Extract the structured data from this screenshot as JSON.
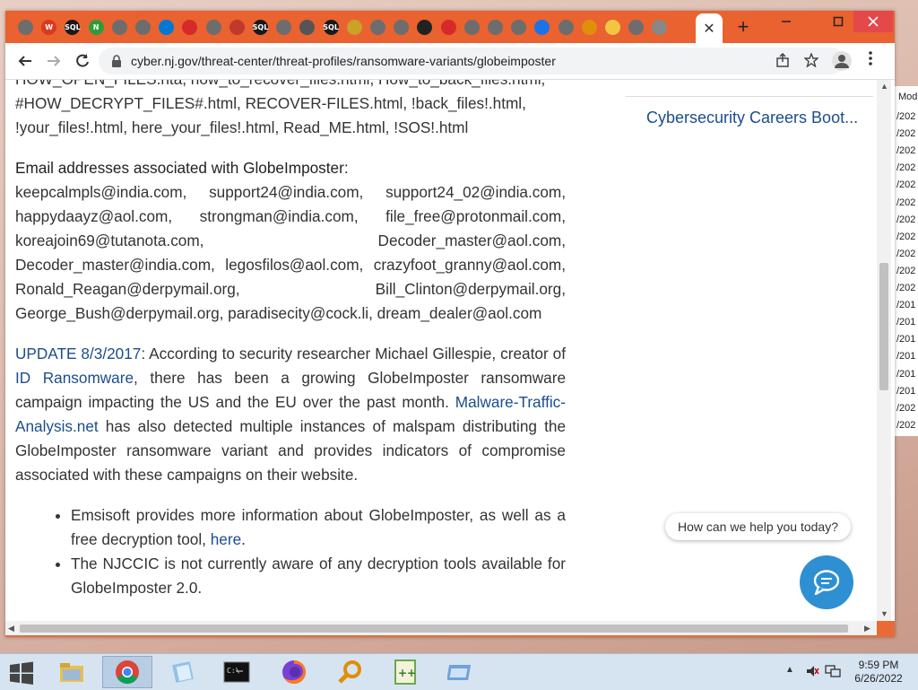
{
  "browser": {
    "url": "cyber.nj.gov/threat-center/threat-profiles/ransomware-variants/globeimposter",
    "active_tab_close": "✕",
    "new_tab": "+"
  },
  "tabs": [
    {
      "name": "tab-favicon-1",
      "bg": "#6d6d6d",
      "label": ""
    },
    {
      "name": "tab-favicon-2",
      "bg": "#d93a1e",
      "label": "W"
    },
    {
      "name": "tab-favicon-3",
      "bg": "#1a1a1a",
      "label": "SQL"
    },
    {
      "name": "tab-favicon-4",
      "bg": "#2e9c3a",
      "label": "N"
    },
    {
      "name": "tab-favicon-5",
      "bg": "#6d6d6d",
      "label": ""
    },
    {
      "name": "tab-favicon-6",
      "bg": "#6d6d6d",
      "label": ""
    },
    {
      "name": "tab-favicon-7",
      "bg": "#0078d4",
      "label": ""
    },
    {
      "name": "tab-favicon-8",
      "bg": "#d62a2a",
      "label": ""
    },
    {
      "name": "tab-favicon-9",
      "bg": "#6d6d6d",
      "label": ""
    },
    {
      "name": "tab-favicon-10",
      "bg": "#c0392b",
      "label": ""
    },
    {
      "name": "tab-favicon-11",
      "bg": "#1a1a1a",
      "label": "SQL"
    },
    {
      "name": "tab-favicon-12",
      "bg": "#6d6d6d",
      "label": ""
    },
    {
      "name": "tab-favicon-13",
      "bg": "#555555",
      "label": ""
    },
    {
      "name": "tab-favicon-14",
      "bg": "#1a1a1a",
      "label": "SQL"
    },
    {
      "name": "tab-favicon-15",
      "bg": "#c9a227",
      "label": ""
    },
    {
      "name": "tab-favicon-16",
      "bg": "#6d6d6d",
      "label": ""
    },
    {
      "name": "tab-favicon-17",
      "bg": "#6d6d6d",
      "label": ""
    },
    {
      "name": "tab-favicon-18",
      "bg": "#222222",
      "label": ""
    },
    {
      "name": "tab-favicon-19",
      "bg": "#d62a2a",
      "label": ""
    },
    {
      "name": "tab-favicon-20",
      "bg": "#6d6d6d",
      "label": ""
    },
    {
      "name": "tab-favicon-21",
      "bg": "#6d6d6d",
      "label": ""
    },
    {
      "name": "tab-favicon-22",
      "bg": "#6d6d6d",
      "label": ""
    },
    {
      "name": "tab-favicon-23",
      "bg": "#1a73e8",
      "label": ""
    },
    {
      "name": "tab-favicon-24",
      "bg": "#6d6d6d",
      "label": ""
    },
    {
      "name": "tab-favicon-25",
      "bg": "#e08e0b",
      "label": ""
    },
    {
      "name": "tab-favicon-26",
      "bg": "#f4c542",
      "label": ""
    },
    {
      "name": "tab-favicon-27",
      "bg": "#6d6d6d",
      "label": ""
    },
    {
      "name": "tab-favicon-28",
      "bg": "#888888",
      "label": ""
    }
  ],
  "content": {
    "files_line_1": "HOW_OPEN_FILES.hta, how_to_recover_files.html, How_to_back_files.html,",
    "files_line_2": "#HOW_DECRYPT_FILES#.html, RECOVER-FILES.html, !back_files!.html,",
    "files_line_3": "!your_files!.html, here_your_files!.html, Read_ME.html, !SOS!.html",
    "email_heading": "Email addresses associated with GlobeImposter:",
    "emails": "keepcalmpls@india.com, support24@india.com, support24_02@india.com, happydaayz@aol.com, strongman@india.com, file_free@protonmail.com, koreajoin69@tutanota.com, Decoder_master@aol.com, Decoder_master@india.com, legosfilos@aol.com, crazyfoot_granny@aol.com, Ronald_Reagan@derpymail.org, Bill_Clinton@derpymail.org, George_Bush@derpymail.org, paradisecity@cock.li, dream_dealer@aol.com",
    "update_link": "UPDATE 8/3/2017",
    "update_text_1": ": According to security researcher Michael Gillespie, creator of ",
    "id_ransomware_link": "ID Ransomware",
    "update_text_2": ", there has been a growing GlobeImposter ransomware campaign impacting the US and the EU over the past month. ",
    "mta_link": "Malware-Traffic-Analysis.net",
    "update_text_3": " has also detected multiple instances of malspam distributing the GlobeImposter ransomware variant and provides indicators of compromise associated with these campaigns on their website.",
    "bullet_1_text": "Emsisoft provides more information about GlobeImposter, as well as a free decryption tool, ",
    "bullet_1_link": "here",
    "bullet_1_end": ".",
    "bullet_2_text": "The NJCCIC is not currently aware of any decryption tools available for GlobeImposter 2.0."
  },
  "sidebar": {
    "link": "Cybersecurity Careers Boot..."
  },
  "chat": {
    "prompt": "How can we help you today?"
  },
  "background_window": {
    "header": "Mod",
    "rows": [
      "/202",
      "/202",
      "/202",
      "/202",
      "/202",
      "/202",
      "/202",
      "/202",
      "/202",
      "/202",
      "/202",
      "/201",
      "/201",
      "/201",
      "/201",
      "/201",
      "/201",
      "/202",
      "/202"
    ]
  },
  "taskbar": {
    "time": "9:59 PM",
    "date": "6/26/2022"
  },
  "colors": {
    "tab_strip": "#e9622f",
    "link": "#1b4d8c",
    "chat_button": "#2e8fd3",
    "taskbar": "#d6e4f2"
  }
}
